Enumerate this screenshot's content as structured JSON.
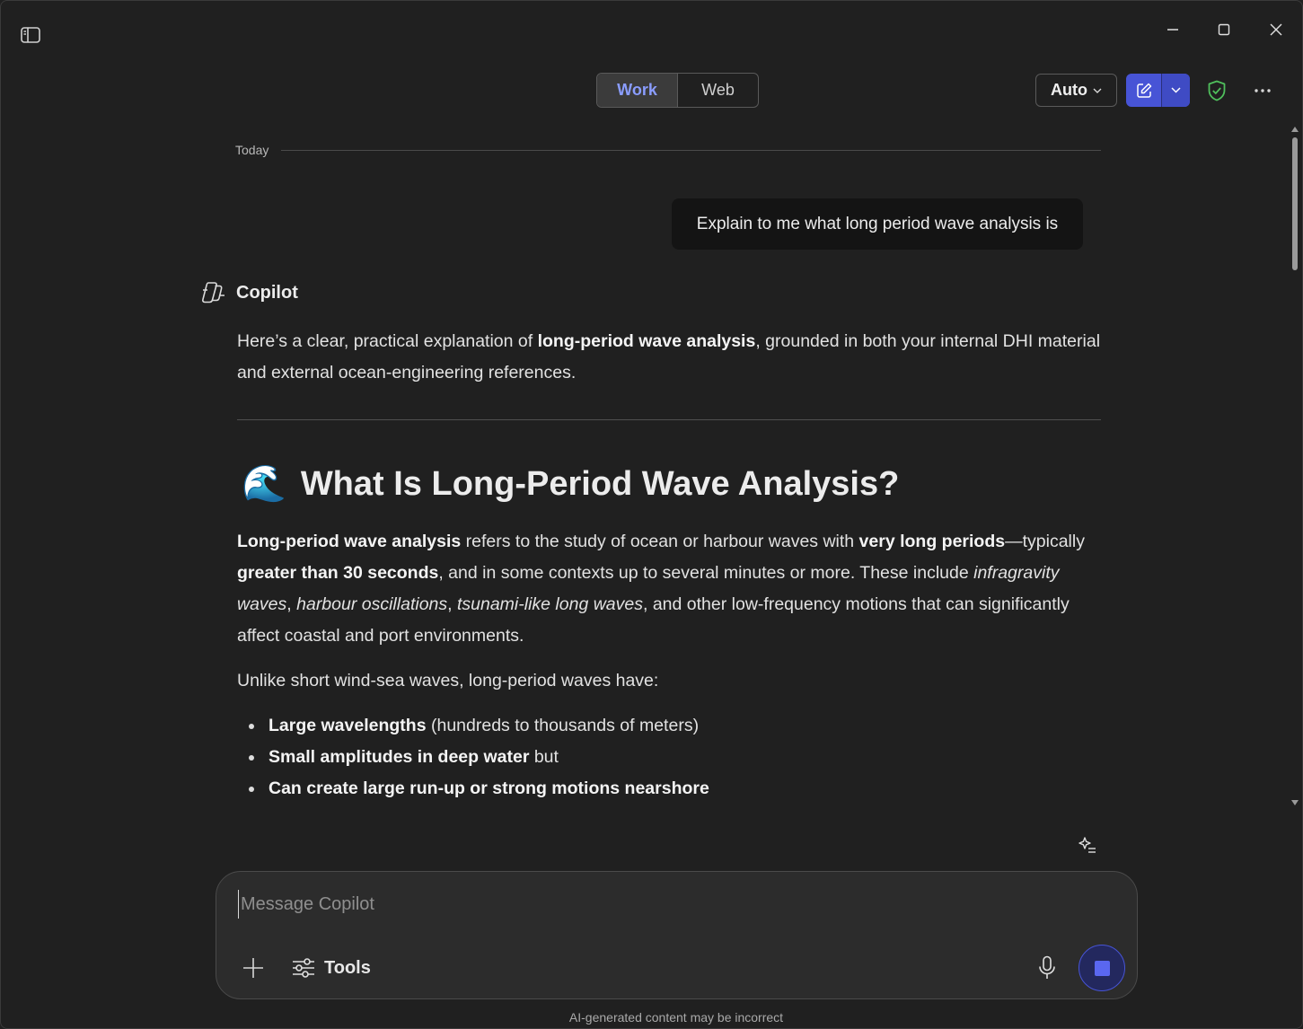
{
  "window": {
    "minimize_icon": "minimize-icon",
    "maximize_icon": "maximize-icon",
    "close_icon": "close-icon",
    "sidebar_icon": "sidebar-toggle-icon"
  },
  "header": {
    "tabs": [
      {
        "label": "Work",
        "active": true
      },
      {
        "label": "Web",
        "active": false
      }
    ],
    "mode_select": {
      "value": "Auto"
    },
    "accent_color": "#4754d6"
  },
  "conversation": {
    "date_divider": "Today",
    "user_message": "Explain to me what long period wave analysis is",
    "assistant_name": "Copilot",
    "intro_pre": "Here’s a clear, practical explanation of ",
    "intro_bold": "long-period wave analysis",
    "intro_post": ", grounded in both your internal DHI material and external ocean-engineering references.",
    "heading_emoji": "🌊",
    "heading": "What Is Long-Period Wave Analysis?",
    "para1": {
      "b1": "Long-period wave analysis",
      "t1": " refers to the study of ocean or harbour waves with ",
      "b2": "very long periods",
      "t2": "—typically ",
      "b3": "greater than 30 seconds",
      "t3": ", and in some contexts up to several minutes or more. These include ",
      "i1": "infragravity waves",
      "t4": ", ",
      "i2": "harbour oscillations",
      "t5": ", ",
      "i3": "tsunami-like long waves",
      "t6": ", and other low-frequency motions that can significantly affect coastal and port environments."
    },
    "para2": "Unlike short wind-sea waves, long-period waves have:",
    "bullets": [
      {
        "bold": "Large wavelengths",
        "text": " (hundreds to thousands of meters)"
      },
      {
        "bold": "Small amplitudes in deep water",
        "text": " but"
      },
      {
        "bold": "Can create large run-up or strong motions nearshore",
        "text": ""
      }
    ]
  },
  "composer": {
    "placeholder": "Message Copilot",
    "value": "",
    "tools_label": "Tools"
  },
  "footer": {
    "disclaimer": "AI-generated content may be incorrect"
  }
}
